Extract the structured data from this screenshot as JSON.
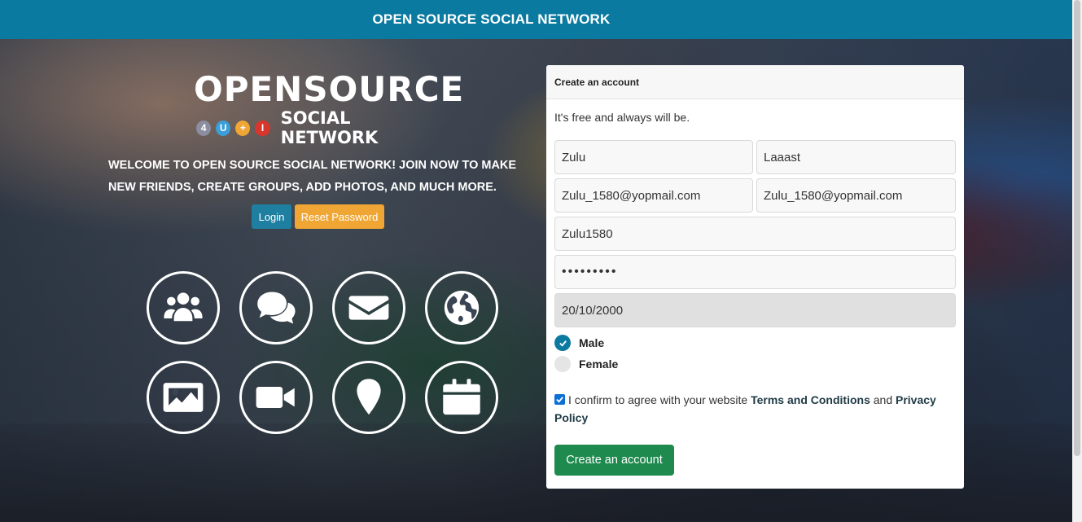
{
  "header": {
    "title": "OPEN SOURCE SOCIAL NETWORK"
  },
  "logo": {
    "main": "OPENSOURCE",
    "badges": [
      {
        "text": "4",
        "color": "#8b8ea0"
      },
      {
        "text": "U",
        "color": "#3a9fd8"
      },
      {
        "text": "+",
        "color": "#f0a634"
      },
      {
        "text": "I",
        "color": "#d8352d"
      }
    ],
    "sub": "SOCIAL NETWORK"
  },
  "welcome": "WELCOME TO OPEN SOURCE SOCIAL NETWORK! JOIN NOW TO MAKE NEW FRIENDS, CREATE GROUPS, ADD PHOTOS, AND MUCH MORE.",
  "buttons": {
    "login": "Login",
    "reset": "Reset Password"
  },
  "features": [
    "users-icon",
    "comments-icon",
    "envelope-icon",
    "globe-icon",
    "image-icon",
    "video-icon",
    "map-marker-icon",
    "calendar-icon"
  ],
  "signup": {
    "title": "Create an account",
    "subtitle": "It's free and always will be.",
    "first_name": "Zulu",
    "last_name": "Laaast",
    "email": "Zulu_1580@yopmail.com",
    "email_confirm": "Zulu_1580@yopmail.com",
    "username": "Zulu1580",
    "password": "•••••••••",
    "birthdate": "20/10/2000",
    "gender_male": "Male",
    "gender_female": "Female",
    "terms_prefix": "I confirm to agree with your website",
    "terms_link": "Terms and Conditions",
    "terms_and": "and",
    "privacy_link": "Privacy Policy",
    "submit": "Create an account"
  },
  "colors": {
    "topbar": "#0b7aa0",
    "login": "#1e7fa0",
    "reset": "#f0a634",
    "create": "#1e8a4e"
  }
}
